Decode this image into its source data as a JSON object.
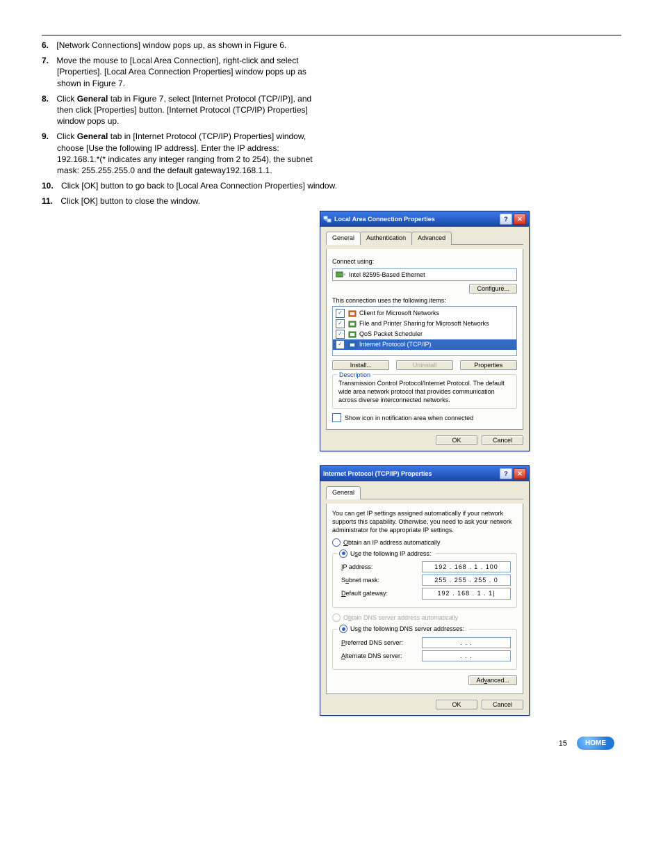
{
  "doc": {
    "steps_intro_a_num": "6.",
    "steps_intro_a": "[Network Connections] window pops up, as shown in Figure 6.",
    "step7_num": "7.",
    "step7_a": "Move the mouse to [Local Area Connection], right-click and select",
    "step7_b": "[Properties]. [Local Area Connection Properties] window pops up as",
    "step7_c": "shown in Figure 7.",
    "step8_num": "8.",
    "step8_a": "Click ",
    "step8_b": "General",
    "step8_c": " tab in Figure 7, select [Internet Protocol (TCP/IP)], and",
    "step8_d": "then click [Properties] button. [Internet Protocol (TCP/IP) Properties]",
    "step8_e": "window pops up.",
    "step9_num": "9.",
    "step9_a": "Click ",
    "step9_b": "General",
    "step9_c": " tab in [Internet Protocol (TCP/IP) Properties] window,",
    "step9_d": "choose [Use the following IP address]. Enter the IP address:",
    "step9_e": "192.168.1.*(* indicates any integer ranging from 2 to 254), the subnet",
    "step9_f": "mask: 255.255.255.0 and the default gateway192.168.1.1.",
    "step10_num": "10.",
    "step10": "Click [OK] button to go back to [Local Area Connection Properties] window.",
    "step11_num": "11.",
    "step11": "Click [OK] button to close the window.",
    "page_number": "15",
    "home_label": "HOME"
  },
  "win1": {
    "title": "Local Area Connection Properties",
    "tabs": {
      "general": "General",
      "auth": "Authentication",
      "adv": "Advanced"
    },
    "connect_using_label": "Connect using:",
    "adapter": "Intel 82595-Based Ethernet",
    "configure_btn": "Configure...",
    "items_label": "This connection uses the following items:",
    "items": [
      {
        "label": "Client for Microsoft Networks"
      },
      {
        "label": "File and Printer Sharing for Microsoft Networks"
      },
      {
        "label": "QoS Packet Scheduler"
      },
      {
        "label": "Internet Protocol (TCP/IP)"
      }
    ],
    "install_btn": "Install...",
    "uninstall_btn": "Uninstall",
    "properties_btn": "Properties",
    "desc_legend": "Description",
    "desc_text": "Transmission Control Protocol/Internet Protocol. The default wide area network protocol that provides communication across diverse interconnected networks.",
    "show_icon": "Show icon in notification area when connected",
    "ok": "OK",
    "cancel": "Cancel"
  },
  "win2": {
    "title": "Internet Protocol (TCP/IP) Properties",
    "tab_general": "General",
    "intro": "You can get IP settings assigned automatically if your network supports this capability. Otherwise, you need to ask your network administrator for the appropriate IP settings.",
    "r_obtain_ip": "Obtain an IP address automatically",
    "r_use_ip": "Use the following IP address:",
    "ip_label": "IP address:",
    "ip_value": "192 . 168 .  1  . 100",
    "subnet_label": "Subnet mask:",
    "subnet_value": "255 . 255 . 255 .  0",
    "gateway_label": "Default gateway:",
    "gateway_value": "192 . 168 .  1  .  1|",
    "r_obtain_dns": "Obtain DNS server address automatically",
    "r_use_dns": "Use the following DNS server addresses:",
    "pref_dns_label": "Preferred DNS server:",
    "pref_dns_value": " .     .     . ",
    "alt_dns_label": "Alternate DNS server:",
    "alt_dns_value": " .     .     . ",
    "advanced_btn": "Advanced...",
    "ok": "OK",
    "cancel": "Cancel"
  }
}
